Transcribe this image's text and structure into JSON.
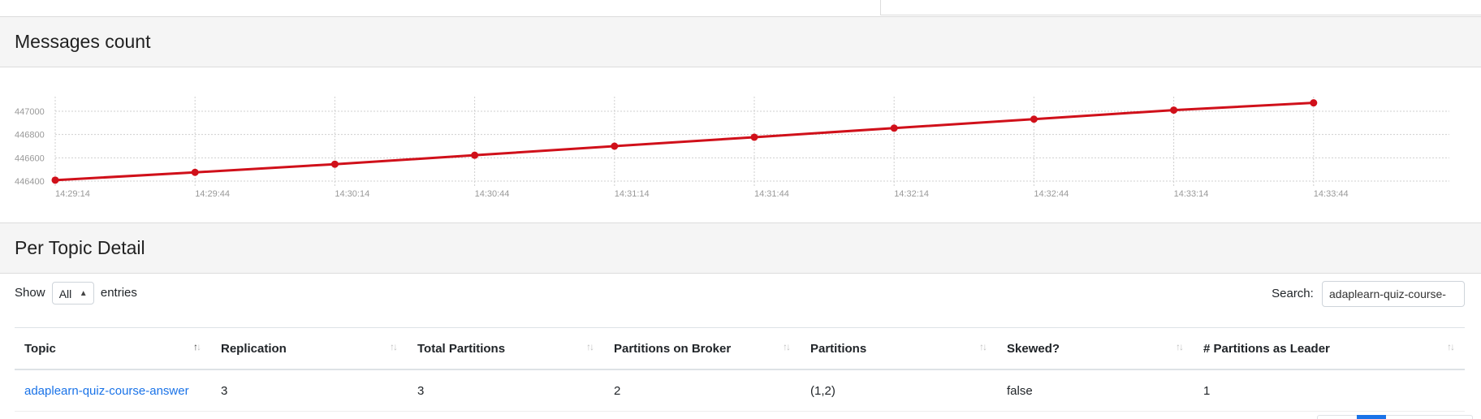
{
  "colors": {
    "series_line": "#d0101a",
    "link": "#1a73e8",
    "panel_header_bg": "#f5f5f5"
  },
  "messages_panel": {
    "title": "Messages count"
  },
  "chart_data": {
    "type": "line",
    "title": "",
    "xlabel": "",
    "ylabel": "",
    "x": [
      "14:29:14",
      "14:29:44",
      "14:30:14",
      "14:30:44",
      "14:31:14",
      "14:31:44",
      "14:32:14",
      "14:32:44",
      "14:33:14",
      "14:33:44"
    ],
    "series": [
      {
        "values": [
          446408,
          446475,
          446545,
          446622,
          446700,
          446777,
          446855,
          446932,
          447010,
          447072
        ]
      }
    ],
    "yticks": [
      446400,
      446600,
      446800,
      447000
    ],
    "ylim": [
      446400,
      447000
    ],
    "grid": true,
    "legend": "none"
  },
  "topic_panel": {
    "title": "Per Topic Detail",
    "show_label": "Show",
    "show_value": "All",
    "entries_label": "entries",
    "search_label": "Search:",
    "search_value": "adaplearn-quiz-course-",
    "columns": [
      "Topic",
      "Replication",
      "Total Partitions",
      "Partitions on Broker",
      "Partitions",
      "Skewed?",
      "# Partitions as Leader"
    ],
    "rows": [
      {
        "topic": "adaplearn-quiz-course-answer",
        "replication": "3",
        "total_partitions": "3",
        "partitions_on_broker": "2",
        "partitions": "(1,2)",
        "skewed": "false",
        "partitions_as_leader": "1"
      }
    ]
  }
}
